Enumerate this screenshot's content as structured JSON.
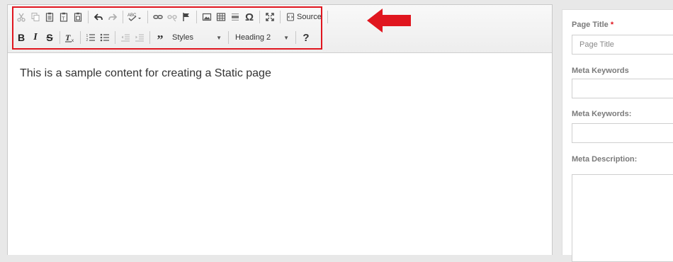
{
  "toolbar": {
    "source_label": "Source",
    "styles_combo": "Styles",
    "format_combo": "Heading 2",
    "help_label": "?",
    "omega_label": "Ω"
  },
  "editor": {
    "content": "This is a sample content for creating a Static page"
  },
  "sidebar": {
    "page_title_label": "Page Title",
    "required_mark": "*",
    "page_title_placeholder": "Page Title",
    "meta_keywords_label": "Meta Keywords",
    "meta_keywords2_label": "Meta Keywords:",
    "meta_description_label": "Meta Description:"
  },
  "annotation": {
    "highlight_color": "#e0161f",
    "arrow_color": "#e0161f"
  }
}
